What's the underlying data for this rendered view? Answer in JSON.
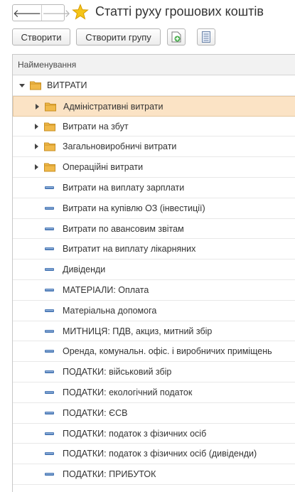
{
  "window": {
    "title": "Статті руху грошових коштів"
  },
  "nav": {
    "back_icon": "arrow-left-icon",
    "forward_icon": "arrow-right-icon",
    "favorite_icon": "star-icon"
  },
  "toolbar": {
    "create_label": "Створити",
    "create_group_label": "Створити групу",
    "copy_icon": "add-copy-icon",
    "list_icon": "list-settings-icon"
  },
  "table": {
    "column_header": "Найменування",
    "root": {
      "label": "ВИТРАТИ",
      "expanded": true
    },
    "groups": [
      {
        "label": "Адміністративні витрати",
        "selected": true
      },
      {
        "label": "Витрати на збут"
      },
      {
        "label": "Загальновиробничі витрати"
      },
      {
        "label": "Операційні витрати"
      }
    ],
    "items": [
      "Витрати на виплату зарплати",
      "Витрати на купівлю ОЗ (інвестиції)",
      "Витрати по авансовим звітам",
      "Витратит на виплату лікарняних",
      "Дивіденди",
      "МАТЕРІАЛИ: Оплата",
      "Матеріальна допомога",
      "МИТНИЦЯ: ПДВ, акциз, митний збір",
      "Оренда, комунальн. офіс. і виробничих приміщень",
      "ПОДАТКИ: військовий збір",
      "ПОДАТКИ: екологічний податок",
      "ПОДАТКИ: ЄСВ",
      "ПОДАТКИ: податок з фізичних осіб",
      "ПОДАТКИ: податок з фізичних осіб (дивіденди)",
      "ПОДАТКИ: ПРИБУТОК"
    ]
  },
  "colors": {
    "selected_row": "#fbe3c5",
    "folder": "#f0b94a",
    "item_icon": "#4a78b5",
    "star": "#f5c518"
  }
}
